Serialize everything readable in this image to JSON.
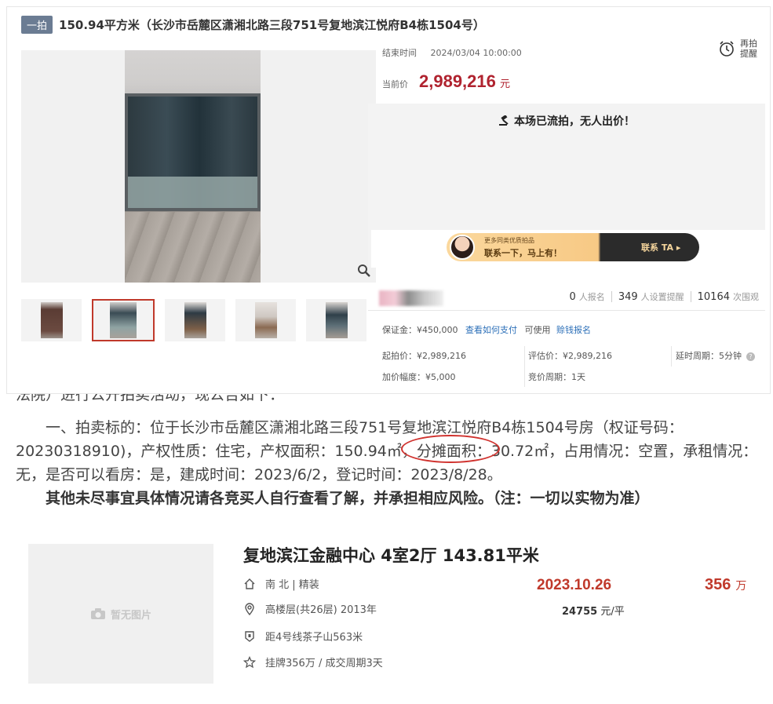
{
  "auction": {
    "badge": "一拍",
    "title": "150.94平方米（长沙市岳麓区潇湘北路三段751号复地滨江悦府B4栋1504号）",
    "end_label": "结束时间",
    "end_time": "2024/03/04 10:00:00",
    "remind_line1": "再拍",
    "remind_line2": "提醒",
    "price_label": "当前价",
    "current_price": "2,989,216",
    "price_unit": "元",
    "status": "本场已流拍，无人出价！",
    "banner_small": "更多同类优质拍品",
    "banner_big": "联系一下，马上有！",
    "banner_cta": "联系 TA ▸",
    "stats": {
      "signup_count": "0",
      "signup_label": "人报名",
      "reminder_count": "349",
      "reminder_label": "人设置提醒",
      "views_count": "10164",
      "views_label": "次围观"
    },
    "deposit": "保证金：¥450,000",
    "how_to_pay": "查看如何支付",
    "can_use": "可使用",
    "credit_signup": "赊钱报名",
    "start_price": "起拍价：¥2,989,216",
    "appraisal": "评估价：¥2,989,216",
    "delay": "延时周期：5分钟",
    "increment": "加价幅度：¥5,000",
    "bid_cycle": "竞价周期：1天"
  },
  "notice": {
    "clipped_line": "法院）进行公开拍卖活动，现公告如下：",
    "para1": "　　一、拍卖标的：位于长沙市岳麓区潇湘北路三段751号复地滨江悦府B4栋1504号房（权证号码：20230318910)，产权性质：住宅，产权面积：150.94㎡，分摊面积：30.72㎡，占用情况：空置，承租情况：无，是否可以看房：是，建成时间：2023/6/2，登记时间：2023/8/28。",
    "para2": "　　其他未尽事宜具体情况请各竞买人自行查看了解，并承担相应风险。（注：一切以实物为准）"
  },
  "listing": {
    "no_image": "暂无图片",
    "title": "复地滨江金融中心 4室2厅 143.81平米",
    "orientation": "南 北 | 精装",
    "floor": "高楼层(共26层) 2013年",
    "subway": "距4号线茶子山563米",
    "listing_info": "挂牌356万 / 成交周期3天",
    "deal_date": "2023.10.26",
    "total_price": "356",
    "total_unit": "万",
    "unit_price": "24755",
    "unit_price_suffix": " 元/平"
  },
  "colors": {
    "accent_red": "#b0232f",
    "link_blue": "#2c6fb8",
    "badge_gray": "#6b7c93"
  }
}
